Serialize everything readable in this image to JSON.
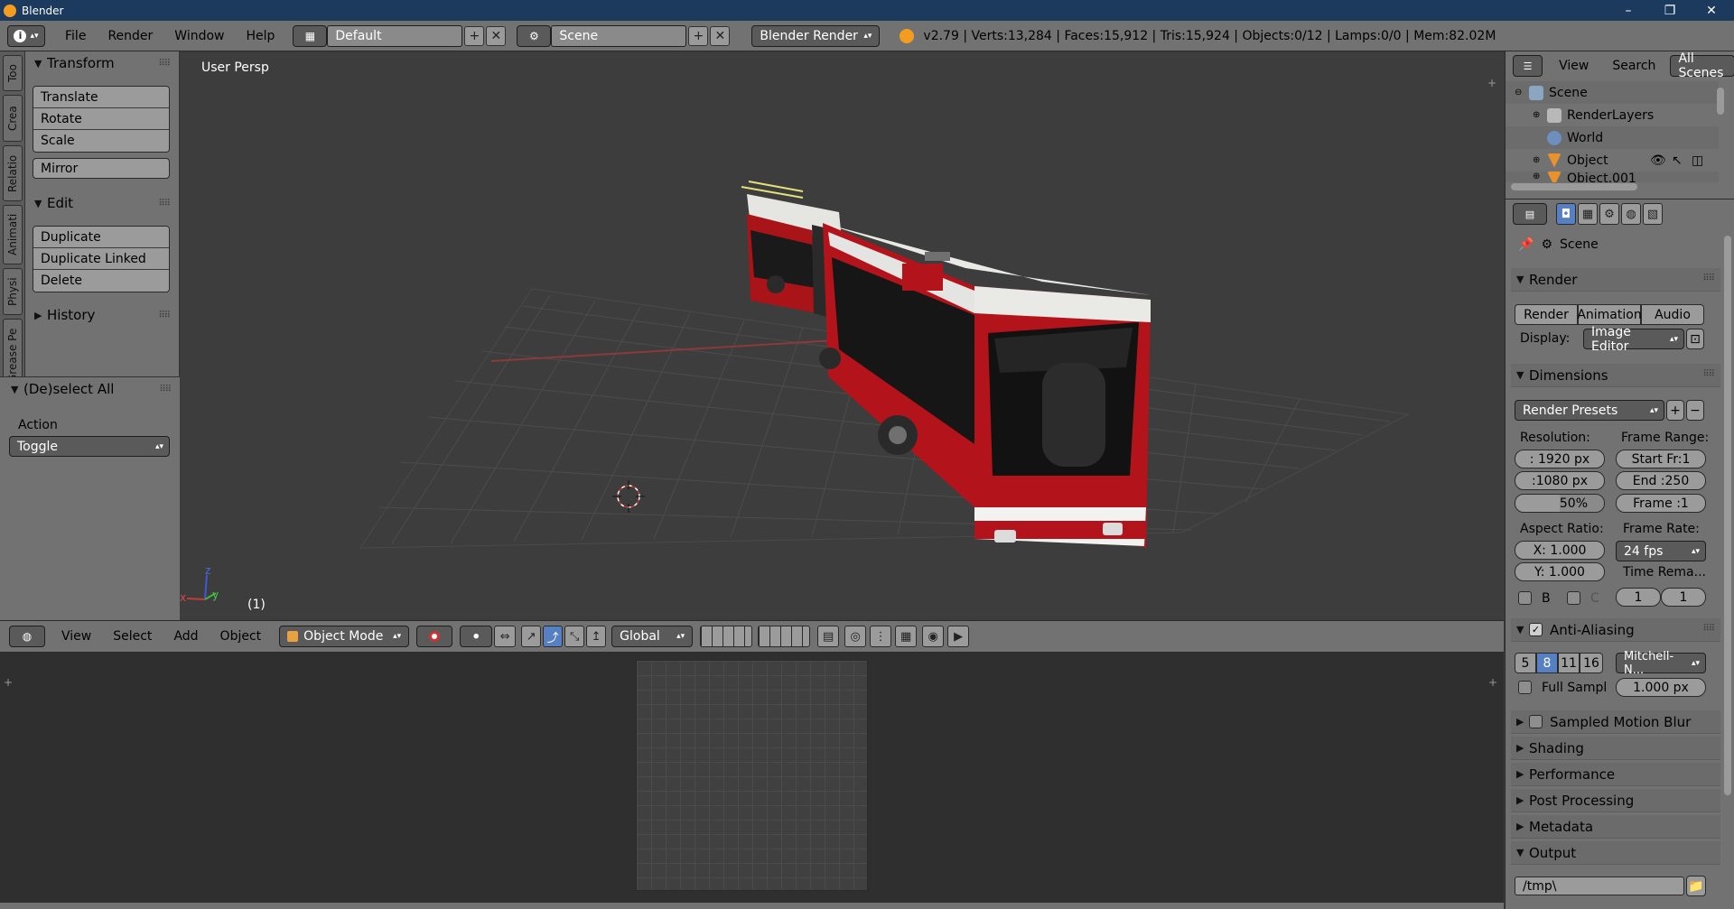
{
  "titlebar": {
    "title": "Blender",
    "min": "–",
    "max": "❐",
    "close": "✕"
  },
  "menu": [
    "File",
    "Render",
    "Window",
    "Help"
  ],
  "screen_layout": "Default",
  "scene_name": "Scene",
  "render_engine": "Blender Render",
  "stats": "v2.79 | Verts:13,284 | Faces:15,912 | Tris:15,924 | Objects:0/12 | Lamps:0/0 | Mem:82.02M",
  "side_tabs": [
    "Too",
    "Crea",
    "Relatio",
    "Animati",
    "Physi",
    "Grease Pe"
  ],
  "toolshelf": {
    "transform_title": "Transform",
    "transform_buttons": [
      "Translate",
      "Rotate",
      "Scale"
    ],
    "mirror": "Mirror",
    "edit_title": "Edit",
    "edit_buttons": [
      "Duplicate",
      "Duplicate Linked",
      "Delete"
    ],
    "history_title": "History"
  },
  "operator": {
    "title": "(De)select All",
    "action_label": "Action",
    "action_value": "Toggle"
  },
  "viewport": {
    "label": "User Persp",
    "frame": "(1)",
    "axis_z": "z",
    "axis_y": "y",
    "axis_x": "x"
  },
  "v3d_header": {
    "menus": [
      "View",
      "Select",
      "Add",
      "Object"
    ],
    "mode": "Object Mode",
    "orientation": "Global"
  },
  "outliner": {
    "view": "View",
    "search": "Search",
    "filter": "All Scenes",
    "rows": [
      "Scene",
      "RenderLayers",
      "World",
      "Object",
      "Object.001"
    ]
  },
  "properties": {
    "context": "Scene",
    "render_title": "Render",
    "render_buttons": [
      "Render",
      "Animation",
      "Audio"
    ],
    "display_label": "Display:",
    "display_value": "Image Editor",
    "dimensions_title": "Dimensions",
    "render_presets": "Render Presets",
    "resolution_label": "Resolution:",
    "res_x": ": 1920 px",
    "res_y": ":1080 px",
    "res_pct": "50%",
    "frame_range_label": "Frame Range:",
    "start": "Start Fr:1",
    "end": "End :250",
    "frame": "Frame :1",
    "aspect_label": "Aspect Ratio:",
    "aspect_x": "X:  1.000",
    "aspect_y": "Y:  1.000",
    "frame_rate_label": "Frame Rate:",
    "fps": "24 fps",
    "time_remap": "Time Rema...",
    "b_label": "B",
    "c_label": "C",
    "remap_old": "1",
    "remap_new": "1",
    "aa_title": "Anti-Aliasing",
    "aa_samples": [
      "5",
      "8",
      "11",
      "16"
    ],
    "aa_filter": "Mitchell-N...",
    "full_sample": "Full Sampl",
    "filter_size": "1.000 px",
    "motion_blur": "Sampled Motion Blur",
    "shading": "Shading",
    "performance": "Performance",
    "post_processing": "Post Processing",
    "metadata": "Metadata",
    "output": "Output",
    "output_path": "/tmp\\"
  },
  "colors": {
    "accent_blue": "#5680c2",
    "bus_red": "#b3141b",
    "bus_white": "#e9e9e6",
    "x_axis": "#a33333"
  }
}
